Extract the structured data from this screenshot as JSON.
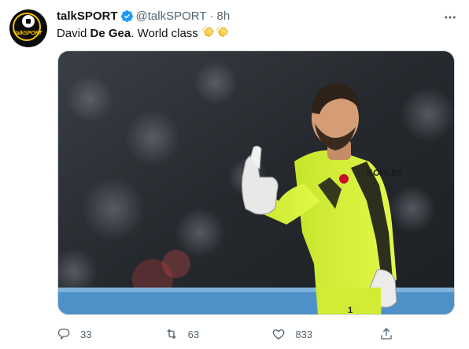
{
  "tweet": {
    "display_name": "talkSPORT",
    "handle": "@talkSPORT",
    "separator": "·",
    "time": "8h",
    "text_before": "David ",
    "text_bold": "De Gea",
    "text_after": ". World class",
    "emoji": [
      "clapping-hands-emoji",
      "clapping-hands-emoji"
    ]
  },
  "avatar": {
    "logo_text": "talkSPORT"
  },
  "media": {
    "kit_sponsor": "KOHLER",
    "shirt_number": "1"
  },
  "actions": {
    "replies": "33",
    "retweets": "63",
    "likes": "833"
  },
  "colors": {
    "text": "#0f1419",
    "secondary": "#536471",
    "verified": "#1d9bf0",
    "brand_yellow": "#f5c400",
    "keeper_kit": "#d8f33a"
  }
}
